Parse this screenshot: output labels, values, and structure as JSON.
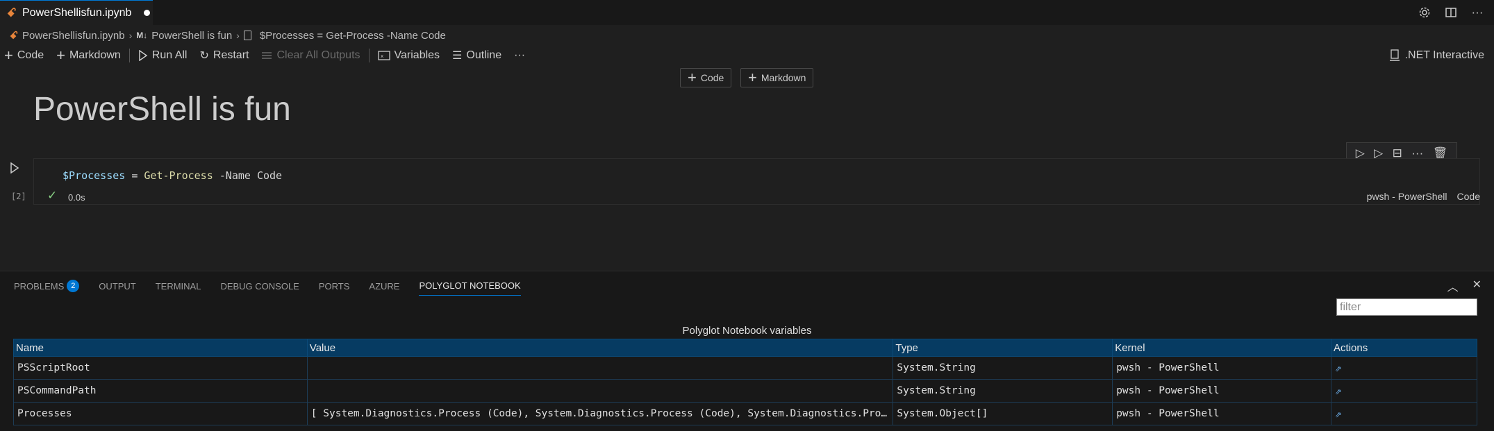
{
  "tab": {
    "title": "PowerShellisfun.ipynb",
    "notebook_icon": "jupyter-notebook-icon",
    "dirty_indicator": "unsaved-dot"
  },
  "breadcrumb": {
    "file": "PowerShellisfun.ipynb",
    "md_badge": "M↓",
    "section": "PowerShell is fun",
    "cell": "$Processes = Get-Process -Name Code"
  },
  "toolbar": {
    "code": "Code",
    "markdown": "Markdown",
    "run_all": "Run All",
    "restart": "Restart",
    "clear_all": "Clear All Outputs",
    "variables": "Variables",
    "outline": "Outline",
    "more": "···",
    "kernel": ".NET Interactive"
  },
  "insert": {
    "code": "Code",
    "markdown": "Markdown"
  },
  "markdown_cell": {
    "heading": "PowerShell is fun"
  },
  "code_cell": {
    "code": {
      "var": "$Processes",
      "op": " = ",
      "cmd": "Get-Process",
      "param": " -Name",
      "arg": " Code"
    },
    "execution_count": "[2]",
    "duration": "0.0s",
    "kernel": "pwsh - PowerShell",
    "language": "Code"
  },
  "panel": {
    "tabs": [
      {
        "label": "PROBLEMS",
        "badge": "2"
      },
      {
        "label": "OUTPUT"
      },
      {
        "label": "TERMINAL"
      },
      {
        "label": "DEBUG CONSOLE"
      },
      {
        "label": "PORTS"
      },
      {
        "label": "AZURE"
      },
      {
        "label": "POLYGLOT NOTEBOOK"
      }
    ],
    "active_tab": "POLYGLOT NOTEBOOK",
    "filter_placeholder": "filter",
    "caption": "Polyglot Notebook variables",
    "columns": [
      "Name",
      "Value",
      "Type",
      "Kernel",
      "Actions"
    ],
    "rows": [
      {
        "name": "PSScriptRoot",
        "value": "",
        "type": "System.String",
        "kernel": "pwsh - PowerShell"
      },
      {
        "name": "PSCommandPath",
        "value": "",
        "type": "System.String",
        "kernel": "pwsh - PowerShell"
      },
      {
        "name": "Processes",
        "value": "[ System.Diagnostics.Process (Code), System.Diagnostics.Process (Code), System.Diagnostics.Process (Code) ]",
        "type": "System.Object[]",
        "kernel": "pwsh - PowerShell"
      }
    ]
  },
  "colors": {
    "accent": "#0078d4",
    "header_bg": "#063b62",
    "success": "#89d185",
    "notebook_orange": "#e8853b"
  }
}
